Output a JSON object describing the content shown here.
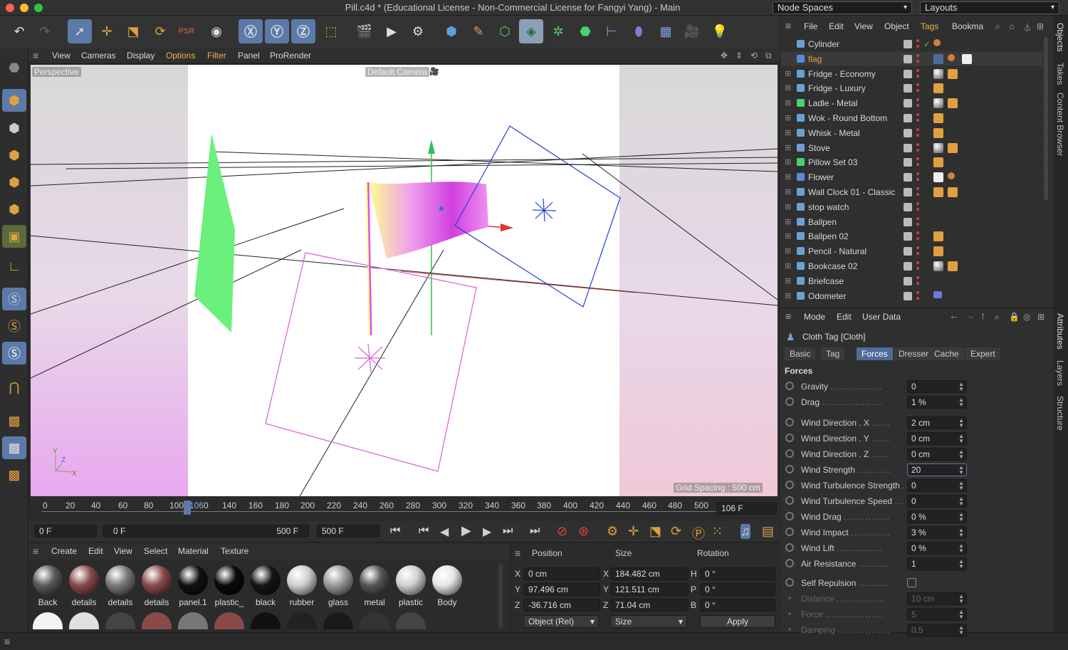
{
  "window": {
    "title": "Pill.c4d * (Educational License - Non-Commercial License for Fangyi Yang) - Main",
    "node_spaces": "Node Spaces",
    "layouts": "Layouts"
  },
  "viewport_menu": [
    "View",
    "Cameras",
    "Display",
    "Options",
    "Filter",
    "Panel",
    "ProRender"
  ],
  "viewport": {
    "view_name": "Perspective",
    "camera": "Default Camera",
    "grid_spacing": "Grid Spacing : 500 cm",
    "axis_x": "X",
    "axis_y": "Y",
    "axis_z": "Z"
  },
  "timeline": {
    "ticks": [
      "0",
      "20",
      "40",
      "60",
      "80",
      "100",
      "106",
      "0",
      "140",
      "160",
      "180",
      "200",
      "220",
      "240",
      "260",
      "280",
      "300",
      "320",
      "340",
      "360",
      "380",
      "400",
      "420",
      "440",
      "460",
      "480",
      "500"
    ],
    "current": "106 F"
  },
  "transport": {
    "start": "0 F",
    "range_start": "0 F",
    "range_end": "500 F",
    "end": "500 F"
  },
  "material_menu": [
    "Create",
    "Edit",
    "View",
    "Select",
    "Material",
    "Texture"
  ],
  "materials": [
    {
      "name": "Back",
      "color": "#5a5a5a"
    },
    {
      "name": "details",
      "color": "#8a4a4a"
    },
    {
      "name": "details",
      "color": "#7a7a7a"
    },
    {
      "name": "details",
      "color": "#8a4a4a"
    },
    {
      "name": "panel.1",
      "color": "#111111"
    },
    {
      "name": "plastic_",
      "color": "#0a0a0a"
    },
    {
      "name": "black",
      "color": "#151515"
    },
    {
      "name": "rubber",
      "color": "#cfcfcf"
    },
    {
      "name": "glass",
      "color": "#9a9a9a"
    },
    {
      "name": "metal",
      "color": "#555555"
    },
    {
      "name": "plastic",
      "color": "#d0d0d0"
    },
    {
      "name": "Body",
      "color": "#e6e6e6"
    }
  ],
  "coords": {
    "headers": [
      "Position",
      "Size",
      "Rotation"
    ],
    "rows": [
      {
        "axis": "X",
        "pos": "0 cm",
        "saxis": "X",
        "size": "184.482 cm",
        "raxis": "H",
        "rot": "0 °"
      },
      {
        "axis": "Y",
        "pos": "97.496 cm",
        "saxis": "Y",
        "size": "121.511 cm",
        "raxis": "P",
        "rot": "0 °"
      },
      {
        "axis": "Z",
        "pos": "-36.716 cm",
        "saxis": "Z",
        "size": "71.04 cm",
        "raxis": "B",
        "rot": "0 °"
      }
    ],
    "mode": "Object (Rel)",
    "size_mode": "Size",
    "apply": "Apply"
  },
  "object_menu": [
    "File",
    "Edit",
    "View",
    "Object",
    "Tags",
    "Bookma"
  ],
  "objects": [
    {
      "name": "Cylinder",
      "color": "#d8d8d8"
    },
    {
      "name": "flag",
      "color": "#e0a040"
    },
    {
      "name": "Fridge - Economy",
      "color": "#d8d8d8"
    },
    {
      "name": "Fridge - Luxury",
      "color": "#d8d8d8"
    },
    {
      "name": "Ladle - Metal",
      "color": "#d8d8d8"
    },
    {
      "name": "Wok - Round Bottom",
      "color": "#d8d8d8"
    },
    {
      "name": "Whisk - Metal",
      "color": "#d8d8d8"
    },
    {
      "name": "Stove",
      "color": "#d8d8d8"
    },
    {
      "name": "Pillow Set 03",
      "color": "#d8d8d8"
    },
    {
      "name": "Flower",
      "color": "#d8d8d8"
    },
    {
      "name": "Wall Clock 01 - Classic",
      "color": "#d8d8d8"
    },
    {
      "name": "stop watch",
      "color": "#d8d8d8"
    },
    {
      "name": "Ballpen",
      "color": "#d8d8d8"
    },
    {
      "name": "Ballpen 02",
      "color": "#d8d8d8"
    },
    {
      "name": "Pencil - Natural",
      "color": "#d8d8d8"
    },
    {
      "name": "Bookcase 02",
      "color": "#d8d8d8"
    },
    {
      "name": "Briefcase",
      "color": "#d8d8d8"
    },
    {
      "name": "Odometer",
      "color": "#d8d8d8"
    }
  ],
  "attr_menu": [
    "Mode",
    "Edit",
    "User Data"
  ],
  "attr_title": "Cloth Tag [Cloth]",
  "attr_tabs": [
    "Basic",
    "Tag",
    "Forces",
    "Dresser",
    "Cache",
    "Expert"
  ],
  "attr_section": "Forces",
  "attrs": [
    {
      "label": "Gravity",
      "value": "0"
    },
    {
      "label": "Drag",
      "value": "1 %"
    },
    {
      "label": "Wind Direction . X",
      "value": "2 cm"
    },
    {
      "label": "Wind Direction . Y",
      "value": "0 cm"
    },
    {
      "label": "Wind Direction . Z",
      "value": "0 cm"
    },
    {
      "label": "Wind Strength",
      "value": "20"
    },
    {
      "label": "Wind Turbulence Strength",
      "value": "0"
    },
    {
      "label": "Wind Turbulence Speed",
      "value": "0"
    },
    {
      "label": "Wind Drag",
      "value": "0 %"
    },
    {
      "label": "Wind Impact",
      "value": "3 %"
    },
    {
      "label": "Wind Lift",
      "value": "0 %"
    },
    {
      "label": "Air Resistance",
      "value": "1"
    },
    {
      "label": "Self Repulsion",
      "value": ""
    },
    {
      "label": "Distance",
      "value": "10 cm"
    },
    {
      "label": "Force",
      "value": "5"
    },
    {
      "label": "Damping",
      "value": "0.5"
    }
  ],
  "side_tabs": [
    "Objects",
    "Takes",
    "Content Browser",
    "Attributes",
    "Layers",
    "Structure"
  ],
  "colors": {
    "accent": "#5c7aa8",
    "flag_green": "#6bf07d",
    "blue_frame": "#1f3fd0",
    "magenta_frame": "#e05ad8"
  }
}
